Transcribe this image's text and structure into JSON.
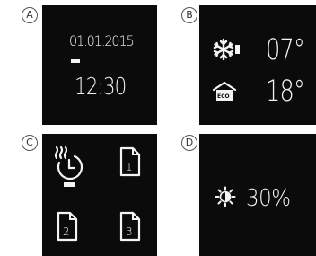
{
  "panels": [
    {
      "badge": "A",
      "date": "01.01.2015",
      "time": "12:30"
    },
    {
      "badge": "B",
      "snow_temp": "07°",
      "eco_label": "ECO",
      "eco_temp": "18°"
    },
    {
      "badge": "C",
      "program_numbers": [
        "1",
        "2",
        "3"
      ]
    },
    {
      "badge": "D",
      "brightness": "30%"
    }
  ],
  "icons": {
    "a": [],
    "b": [
      "snowflake-icon",
      "eco-house-icon"
    ],
    "c": [
      "heat-timer-icon",
      "program-1-icon",
      "program-2-icon",
      "program-3-icon"
    ],
    "d": [
      "brightness-sun-icon"
    ]
  },
  "colors": {
    "screen": "#0b0b0b",
    "foreground": "#f4f4f4",
    "badge_border": "#555555"
  }
}
